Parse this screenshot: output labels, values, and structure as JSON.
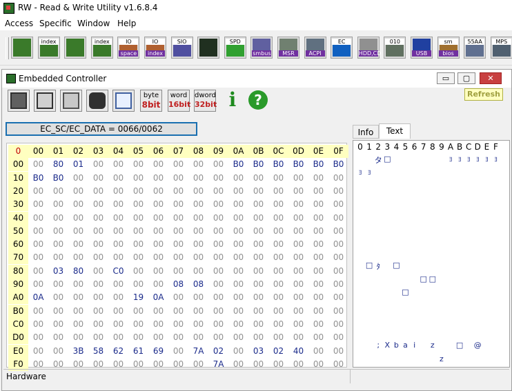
{
  "app": {
    "title": "RW - Read & Write Utility v1.6.8.4"
  },
  "menu": [
    "Access",
    "Specific",
    "Window",
    "Help"
  ],
  "toolbar": [
    {
      "name": "pci",
      "top": "",
      "bot": ""
    },
    {
      "name": "pci-index",
      "top": "index",
      "bot": ""
    },
    {
      "name": "memory",
      "top": "",
      "bot": ""
    },
    {
      "name": "memory-index",
      "top": "index",
      "bot": ""
    },
    {
      "name": "io-space",
      "top": "IO",
      "bot": "space"
    },
    {
      "name": "io-index",
      "top": "IO",
      "bot": "index"
    },
    {
      "name": "sio",
      "top": "SIO",
      "bot": ""
    },
    {
      "name": "waveform",
      "top": "",
      "bot": ""
    },
    {
      "name": "spd",
      "top": "SPD",
      "bot": ""
    },
    {
      "name": "smbus",
      "top": "",
      "bot": "smbus"
    },
    {
      "name": "msr",
      "top": "",
      "bot": "MSR"
    },
    {
      "name": "acpi",
      "top": "",
      "bot": "ACPI"
    },
    {
      "name": "ec",
      "top": "EC",
      "bot": ""
    },
    {
      "name": "hdd",
      "top": "",
      "bot": "HDD,CD"
    },
    {
      "name": "disk",
      "top": "010",
      "bot": ""
    },
    {
      "name": "usb",
      "top": "",
      "bot": "USB"
    },
    {
      "name": "smbios",
      "top": "sm",
      "bot": "bios"
    },
    {
      "name": "55aa",
      "top": "55AA",
      "bot": ""
    },
    {
      "name": "mps",
      "top": "MPS",
      "bot": ""
    }
  ],
  "window": {
    "title": "Embedded Controller",
    "min": "▭",
    "max": "▢",
    "close": "✕"
  },
  "ec_toolbar": {
    "byte_top": "byte",
    "byte_bot": "8bit",
    "word_top": "word",
    "word_bot": "16bit",
    "dword_top": "dword",
    "dword_bot": "32bit",
    "info": "i",
    "help": "?"
  },
  "refresh_label": "Refresh",
  "address_label": "EC_SC/EC_DATA = 0066/0062",
  "grid": {
    "corner": "0",
    "col_headers": [
      "00",
      "01",
      "02",
      "03",
      "04",
      "05",
      "06",
      "07",
      "08",
      "09",
      "0A",
      "0B",
      "0C",
      "0D",
      "0E",
      "0F"
    ],
    "row_headers": [
      "00",
      "10",
      "20",
      "30",
      "40",
      "50",
      "60",
      "70",
      "80",
      "90",
      "A0",
      "B0",
      "C0",
      "D0",
      "E0",
      "F0"
    ],
    "rows": [
      [
        "00",
        "80",
        "01",
        "00",
        "00",
        "00",
        "00",
        "00",
        "00",
        "00",
        "B0",
        "B0",
        "B0",
        "B0",
        "B0",
        "B0"
      ],
      [
        "B0",
        "B0",
        "00",
        "00",
        "00",
        "00",
        "00",
        "00",
        "00",
        "00",
        "00",
        "00",
        "00",
        "00",
        "00",
        "00"
      ],
      [
        "00",
        "00",
        "00",
        "00",
        "00",
        "00",
        "00",
        "00",
        "00",
        "00",
        "00",
        "00",
        "00",
        "00",
        "00",
        "00"
      ],
      [
        "00",
        "00",
        "00",
        "00",
        "00",
        "00",
        "00",
        "00",
        "00",
        "00",
        "00",
        "00",
        "00",
        "00",
        "00",
        "00"
      ],
      [
        "00",
        "00",
        "00",
        "00",
        "00",
        "00",
        "00",
        "00",
        "00",
        "00",
        "00",
        "00",
        "00",
        "00",
        "00",
        "00"
      ],
      [
        "00",
        "00",
        "00",
        "00",
        "00",
        "00",
        "00",
        "00",
        "00",
        "00",
        "00",
        "00",
        "00",
        "00",
        "00",
        "00"
      ],
      [
        "00",
        "00",
        "00",
        "00",
        "00",
        "00",
        "00",
        "00",
        "00",
        "00",
        "00",
        "00",
        "00",
        "00",
        "00",
        "00"
      ],
      [
        "00",
        "00",
        "00",
        "00",
        "00",
        "00",
        "00",
        "00",
        "00",
        "00",
        "00",
        "00",
        "00",
        "00",
        "00",
        "00"
      ],
      [
        "00",
        "03",
        "80",
        "00",
        "C0",
        "00",
        "00",
        "00",
        "00",
        "00",
        "00",
        "00",
        "00",
        "00",
        "00",
        "00"
      ],
      [
        "00",
        "00",
        "00",
        "00",
        "00",
        "00",
        "00",
        "08",
        "08",
        "00",
        "00",
        "00",
        "00",
        "00",
        "00",
        "00"
      ],
      [
        "0A",
        "00",
        "00",
        "00",
        "00",
        "19",
        "0A",
        "00",
        "00",
        "00",
        "00",
        "00",
        "00",
        "00",
        "00",
        "00"
      ],
      [
        "00",
        "00",
        "00",
        "00",
        "00",
        "00",
        "00",
        "00",
        "00",
        "00",
        "00",
        "00",
        "00",
        "00",
        "00",
        "00"
      ],
      [
        "00",
        "00",
        "00",
        "00",
        "00",
        "00",
        "00",
        "00",
        "00",
        "00",
        "00",
        "00",
        "00",
        "00",
        "00",
        "00"
      ],
      [
        "00",
        "00",
        "00",
        "00",
        "00",
        "00",
        "00",
        "00",
        "00",
        "00",
        "00",
        "00",
        "00",
        "00",
        "00",
        "00"
      ],
      [
        "00",
        "00",
        "3B",
        "58",
        "62",
        "61",
        "69",
        "00",
        "7A",
        "02",
        "00",
        "03",
        "02",
        "40",
        "00",
        "00"
      ],
      [
        "00",
        "00",
        "00",
        "00",
        "00",
        "00",
        "00",
        "00",
        "00",
        "7A",
        "00",
        "00",
        "00",
        "00",
        "00",
        "00"
      ]
    ]
  },
  "tabs": [
    "Info",
    "Text"
  ],
  "text_panel": {
    "headers": [
      "0",
      "1",
      "2",
      "3",
      "4",
      "5",
      "6",
      "7",
      "8",
      "9",
      "A",
      "B",
      "C",
      "D",
      "E",
      "F"
    ],
    "rows": [
      [
        "",
        "",
        "タ",
        "□",
        "",
        "",
        "",
        "",
        "",
        "",
        "",
        "",
        "",
        "",
        "",
        ""
      ],
      [
        "",
        "",
        "",
        "",
        "",
        "",
        "",
        "",
        "",
        "",
        "",
        "",
        "",
        "",
        "",
        ""
      ],
      [
        "",
        "",
        "",
        "",
        "",
        "",
        "",
        "",
        "",
        "",
        "",
        "",
        "",
        "",
        "",
        ""
      ],
      [
        "",
        "",
        "",
        "",
        "",
        "",
        "",
        "",
        "",
        "",
        "",
        "",
        "",
        "",
        "",
        ""
      ],
      [
        "",
        "",
        "",
        "",
        "",
        "",
        "",
        "",
        "",
        "",
        "",
        "",
        "",
        "",
        "",
        ""
      ],
      [
        "",
        "",
        "",
        "",
        "",
        "",
        "",
        "",
        "",
        "",
        "",
        "",
        "",
        "",
        "",
        ""
      ],
      [
        "",
        "",
        "",
        "",
        "",
        "",
        "",
        "",
        "",
        "",
        "",
        "",
        "",
        "",
        "",
        ""
      ],
      [
        "",
        "",
        "",
        "",
        "",
        "",
        "",
        "",
        "",
        "",
        "",
        "",
        "",
        "",
        "",
        ""
      ],
      [
        "",
        "□",
        "ﾀ",
        "",
        "□",
        "",
        "",
        "",
        "",
        "",
        "",
        "",
        "",
        "",
        "",
        ""
      ],
      [
        "",
        "",
        "",
        "",
        "",
        "",
        "",
        "□",
        "□",
        "",
        "",
        "",
        "",
        "",
        "",
        ""
      ],
      [
        "",
        "",
        "",
        "",
        "",
        "□",
        "",
        "",
        "",
        "",
        "",
        "",
        "",
        "",
        "",
        ""
      ],
      [
        "",
        "",
        "",
        "",
        "",
        "",
        "",
        "",
        "",
        "",
        "",
        "",
        "",
        "",
        "",
        ""
      ],
      [
        "",
        "",
        "",
        "",
        "",
        "",
        "",
        "",
        "",
        "",
        "",
        "",
        "",
        "",
        "",
        ""
      ],
      [
        "",
        "",
        "",
        "",
        "",
        "",
        "",
        "",
        "",
        "",
        "",
        "",
        "",
        "",
        "",
        ""
      ],
      [
        "",
        "",
        ";",
        "X",
        "b",
        "a",
        "i",
        "",
        "z",
        "",
        "",
        "□",
        "",
        "@",
        "",
        ""
      ],
      [
        "",
        "",
        "",
        "",
        "",
        "",
        "",
        "",
        "",
        "z",
        "",
        "",
        "",
        "",
        "",
        ""
      ]
    ],
    "extra_row0": [
      "ﾖ",
      "ﾖ",
      "ﾖ",
      "ﾖ",
      "ﾖ",
      "ﾖ"
    ],
    "extra_row1": [
      "ﾖ",
      "ﾖ"
    ]
  },
  "status": {
    "text": "Hardware"
  }
}
